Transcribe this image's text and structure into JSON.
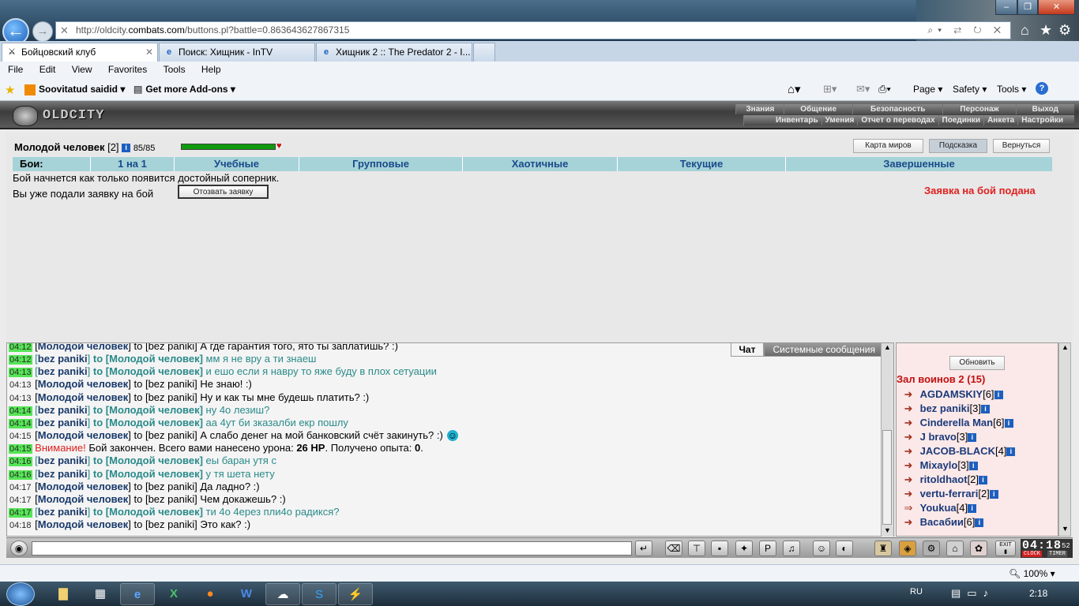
{
  "browser": {
    "url_prefix": "http://oldcity.",
    "url_domain": "combats.com",
    "url_suffix": "/buttons.pl?battle=0.863643627867315",
    "tabs": [
      {
        "label": "Бойцовский клуб",
        "active": true
      },
      {
        "label": "Поиск: Хищник - InTV",
        "active": false
      },
      {
        "label": "Хищник 2 :: The Predator 2 - I...",
        "active": false
      }
    ],
    "menu": [
      "File",
      "Edit",
      "View",
      "Favorites",
      "Tools",
      "Help"
    ],
    "favorites": [
      "Soovitatud saidid",
      "Get more Add-ons"
    ],
    "command_bar": [
      "Page",
      "Safety",
      "Tools"
    ],
    "zoom": "100%"
  },
  "game": {
    "logo": "OLDCITY",
    "top_menu_row1": [
      "Знания",
      "Общение",
      "Безопасность",
      "Персонаж",
      "Выход"
    ],
    "top_menu_row2": [
      "Инвентарь",
      "Умения",
      "Отчет о переводах",
      "Поединки",
      "Анкета",
      "Настройки"
    ],
    "character": {
      "name": "Молодой человек",
      "level": "[2]",
      "hp": "85/85",
      "hp_fraction": 1.0
    },
    "buttons": {
      "map": "Карта миров",
      "hint": "Подсказка",
      "back": "Вернуться",
      "withdraw": "Отозвать заявку",
      "refresh": "Обновить"
    },
    "battle_tabs": [
      "Бои:",
      "1 на 1",
      "Учебные",
      "Групповые",
      "Хаотичные",
      "Текущие",
      "Завершенные"
    ],
    "status_line1": "Бой начнется как только появится достойный соперник.",
    "status_line2": "Вы уже подали заявку на бой",
    "request_submitted": "Заявка на бой подана",
    "chat_tabs": {
      "chat": "Чат",
      "system": "Системные сообщения"
    },
    "hall_title": "Зал воинов 2 (15)"
  },
  "chat": [
    {
      "time": "04:12",
      "green": true,
      "from": "Молодой человек",
      "to": "bez paniki",
      "private": false,
      "text": "А где гарантия того, ято ты заплатишь? :)"
    },
    {
      "time": "04:12",
      "green": true,
      "from": "bez paniki",
      "to": "Молодой человек",
      "private": true,
      "text": "мм я не вру а ти знаеш"
    },
    {
      "time": "04:13",
      "green": true,
      "from": "bez paniki",
      "to": "Молодой человек",
      "private": true,
      "text": "и ешо если я навру то яже буду в плох сетуации"
    },
    {
      "time": "04:13",
      "green": false,
      "from": "Молодой человек",
      "to": "bez paniki",
      "private": false,
      "text": "Не знаю! :)"
    },
    {
      "time": "04:13",
      "green": false,
      "from": "Молодой человек",
      "to": "bez paniki",
      "private": false,
      "text": "Ну и как ты мне будешь платить? :)"
    },
    {
      "time": "04:14",
      "green": true,
      "from": "bez paniki",
      "to": "Молодой человек",
      "private": true,
      "text": "ну 4о лезиш?"
    },
    {
      "time": "04:14",
      "green": true,
      "from": "bez paniki",
      "to": "Молодой человек",
      "private": true,
      "text": "аа 4ут би зказалби екр пошлу"
    },
    {
      "time": "04:15",
      "green": false,
      "from": "Молодой человек",
      "to": "bez paniki",
      "private": false,
      "text": "А слабо денег на мой банковский счёт закинуть? :)"
    },
    {
      "time": "04:15",
      "green": true,
      "system": true,
      "warn": "Внимание!",
      "text": "Бой закончен. Всего вами нанесено урона:",
      "damage": "26 HP",
      "text2": ". Получено опыта:",
      "exp": "0",
      "text3": "."
    },
    {
      "time": "04:16",
      "green": true,
      "from": "bez paniki",
      "to": "Молодой человек",
      "private": true,
      "text": "еы баран утя с"
    },
    {
      "time": "04:16",
      "green": true,
      "from": "bez paniki",
      "to": "Молодой человек",
      "private": true,
      "text": "у тя шета нету"
    },
    {
      "time": "04:17",
      "green": false,
      "from": "Молодой человек",
      "to": "bez paniki",
      "private": false,
      "text": "Да ладно? :)"
    },
    {
      "time": "04:17",
      "green": false,
      "from": "Молодой человек",
      "to": "bez paniki",
      "private": false,
      "text": "Чем докажешь? :)"
    },
    {
      "time": "04:17",
      "green": true,
      "from": "bez paniki",
      "to": "Молодой человек",
      "private": true,
      "text": "ти 4о 4ерез пли4о радикся?"
    },
    {
      "time": "04:18",
      "green": false,
      "from": "Молодой человек",
      "to": "bez paniki",
      "private": false,
      "text": "Это как? :)"
    }
  ],
  "chat_words": {
    "to": "to"
  },
  "users": [
    {
      "name": "AGDAMSKIY",
      "level": "[6]"
    },
    {
      "name": "bez paniki",
      "level": "[3]"
    },
    {
      "name": "Cinderella Man",
      "level": "[6]"
    },
    {
      "name": "J bravo",
      "level": "[3]"
    },
    {
      "name": "JACOB-BLACK",
      "level": "[4]"
    },
    {
      "name": "Mixaylo",
      "level": "[3]"
    },
    {
      "name": "ritoldhaot",
      "level": "[2]"
    },
    {
      "name": "vertu-ferrari",
      "level": "[2]"
    },
    {
      "name": "Youkua",
      "level": "[4]"
    },
    {
      "name": "Васабии",
      "level": "[6]"
    }
  ],
  "clock": {
    "time": "04:18",
    "seconds": "52",
    "label_clock": "CLOCK",
    "label_timer": "TIMER",
    "exit": "EXIT"
  },
  "taskbar": {
    "lang": "RU",
    "time": "2:18"
  }
}
